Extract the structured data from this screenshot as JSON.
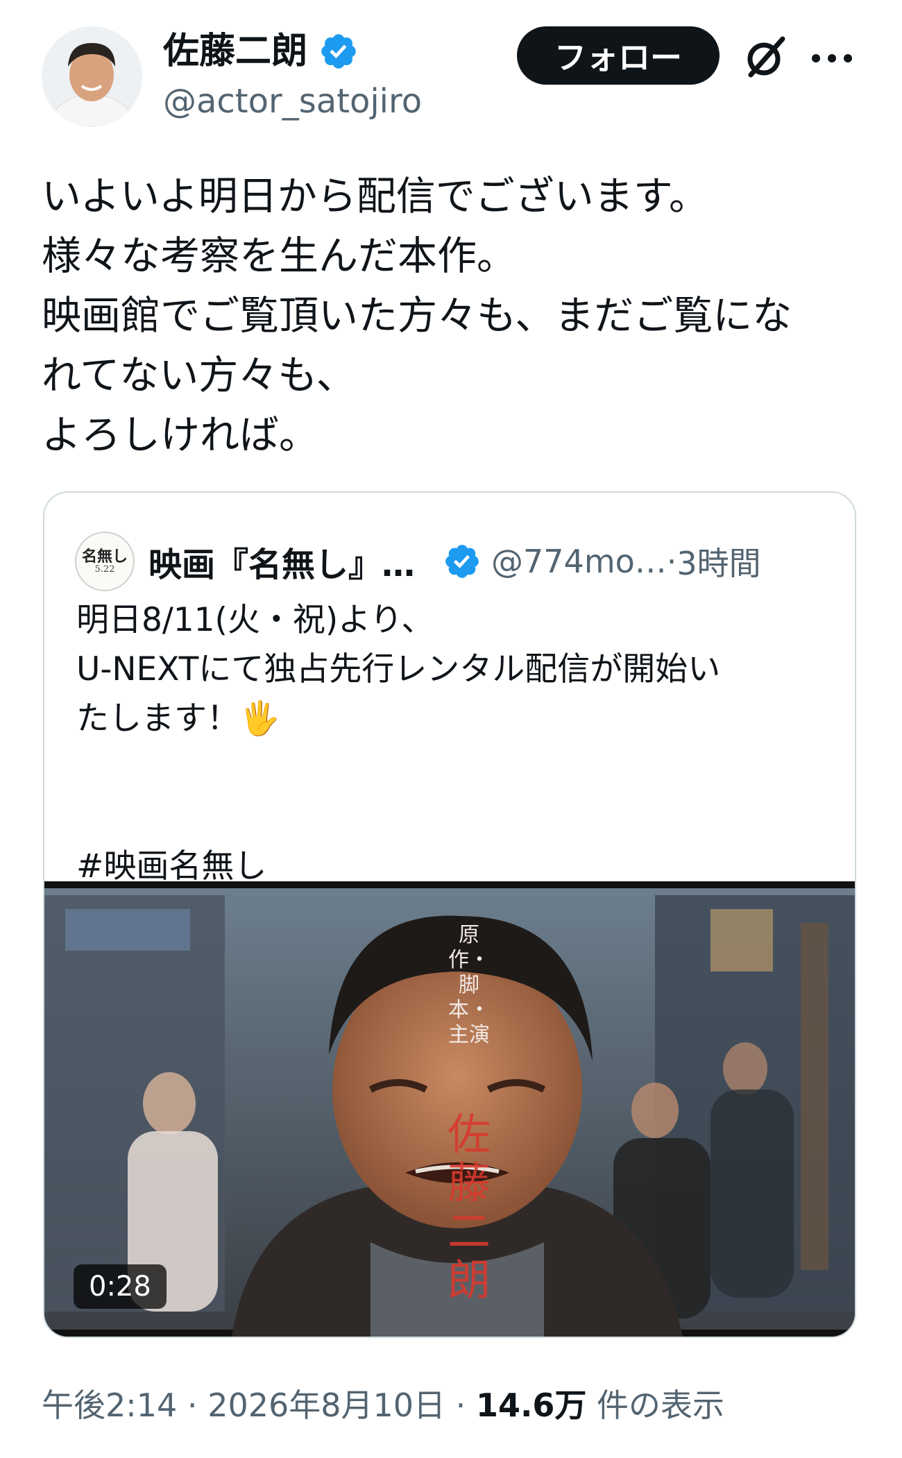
{
  "author": {
    "name": "佐藤二朗",
    "handle": "@actor_satojiro",
    "verified": true
  },
  "header": {
    "follow_label": "フォロー",
    "icons": [
      "grok-icon",
      "more-icon"
    ]
  },
  "tweet": {
    "text": "いよいよ明日から配信でございます。\n様々な考察を生んだ本作。\n映画館でご覧頂いた方々も、まだご覧にな\nれてない方々も、\nよろしければ。"
  },
  "quote": {
    "avatar_line1": "名無し",
    "avatar_line2": "5.22",
    "name": "映画『名無し』…",
    "handle": "@774mo…",
    "separator": " · ",
    "time": "3時間",
    "text": "明日8/11(火・祝)より、\nU-NEXTにて独占先行レンタル配信が開始い\nたします！🖐",
    "hashtag": "#映画名無し",
    "video": {
      "duration": "0:28",
      "credit": "原作・脚本・主演",
      "credit_name": "佐藤二朗"
    }
  },
  "meta": {
    "time": "午後2:14",
    "date": "2026年8月10日",
    "separator": " · ",
    "views": "14.6万",
    "views_label": " 件の表示"
  },
  "colors": {
    "text": "#0f1419",
    "secondary": "#536471",
    "verified_blue": "#1d9bf0",
    "border": "#cfd9de"
  }
}
